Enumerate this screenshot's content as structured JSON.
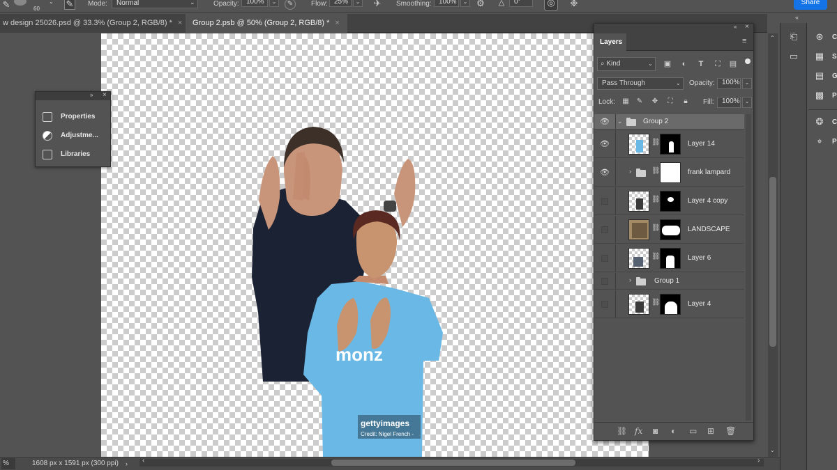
{
  "options_bar": {
    "brush_size": "60",
    "mode_label": "Mode:",
    "mode_value": "Normal",
    "opacity_label": "Opacity:",
    "opacity_value": "100%",
    "flow_label": "Flow:",
    "flow_value": "25%",
    "smoothing_label": "Smoothing:",
    "smoothing_value": "100%",
    "angle_value": "0°",
    "share_label": "Share"
  },
  "tabs": [
    {
      "label": "w design 25026.psd @ 33.3% (Group 2, RGB/8) *",
      "close": "×"
    },
    {
      "label": "Group 2.psb @ 50% (Group 2, RGB/8) *",
      "close": "×"
    }
  ],
  "canvas": {
    "watermark_brand": "gettyimages",
    "watermark_credit": "Credit: Nigel French -",
    "shirt_text": "monz"
  },
  "float_panel": {
    "items": [
      "Properties",
      "Adjustme...",
      "Libraries"
    ]
  },
  "layers_panel": {
    "title": "Layers",
    "filter_kind": "Kind",
    "blend_mode": "Pass Through",
    "opacity_label": "Opacity:",
    "opacity_value": "100%",
    "lock_label": "Lock:",
    "fill_label": "Fill:",
    "fill_value": "100%",
    "layers": [
      {
        "name": "Group 2",
        "visible": true,
        "type": "group"
      },
      {
        "name": "Layer 14",
        "visible": true,
        "type": "layer"
      },
      {
        "name": "frank lampard",
        "visible": true,
        "type": "group"
      },
      {
        "name": "Layer 4 copy",
        "visible": false,
        "type": "layer"
      },
      {
        "name": "LANDSCAPE",
        "visible": false,
        "type": "layer"
      },
      {
        "name": "Layer 6",
        "visible": false,
        "type": "layer"
      },
      {
        "name": "Group 1",
        "visible": false,
        "type": "group"
      },
      {
        "name": "Layer 4",
        "visible": false,
        "type": "layer"
      }
    ]
  },
  "status": {
    "zoom": "%",
    "doc_size": "1608 px x 1591 px (300 ppi)"
  },
  "right_panel": {
    "labels": [
      "C",
      "S",
      "G",
      "P",
      "C",
      "P"
    ]
  },
  "colors": {
    "accent": "#1473e6",
    "ui_bg": "#535353",
    "panel_dark": "#424242",
    "selected_row": "#6a6a6a"
  }
}
